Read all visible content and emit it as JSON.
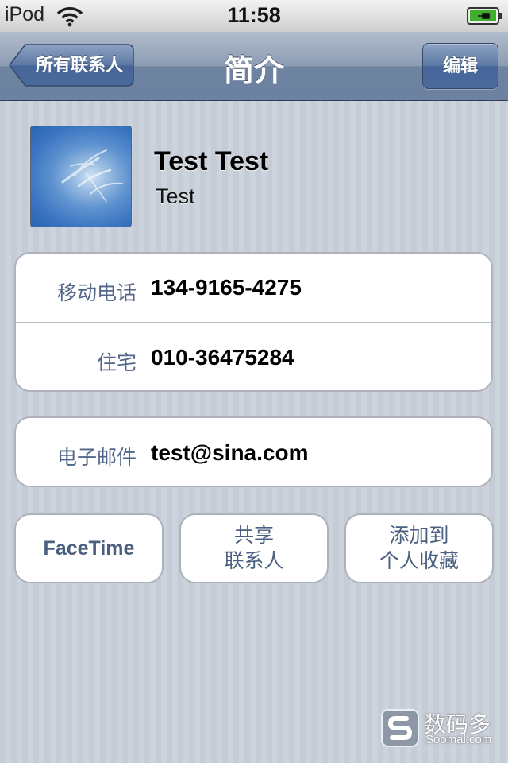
{
  "status_bar": {
    "carrier": "iPod",
    "time": "11:58",
    "wifi_icon": "wifi-icon",
    "battery_icon": "battery-charging-icon"
  },
  "nav": {
    "back_label": "所有联系人",
    "title": "简介",
    "edit_label": "编辑"
  },
  "contact": {
    "name": "Test Test",
    "company": "Test"
  },
  "phones": [
    {
      "label": "移动电话",
      "value": "134-9165-4275"
    },
    {
      "label": "住宅",
      "value": "010-36475284"
    }
  ],
  "emails": [
    {
      "label": "电子邮件",
      "value": "test@sina.com"
    }
  ],
  "actions": {
    "facetime": "FaceTime",
    "share_line1": "共享",
    "share_line2": "联系人",
    "favorite_line1": "添加到",
    "favorite_line2": "个人收藏"
  },
  "watermark": {
    "cn": "数码多",
    "en": "Soomal.com"
  },
  "colors": {
    "nav_bar": "#6d83a0",
    "label_blue": "#52668a",
    "background": "#c5ccd6"
  }
}
